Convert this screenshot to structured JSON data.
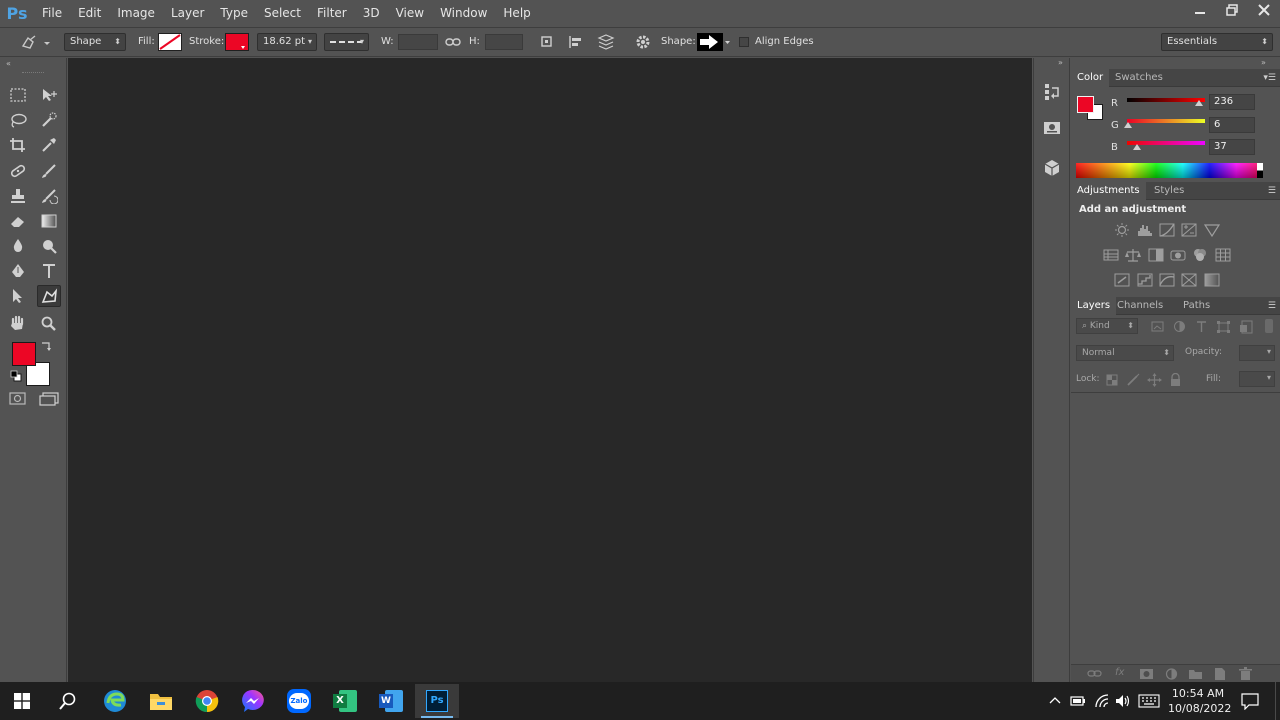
{
  "app": {
    "logo": "Ps"
  },
  "menu": [
    "File",
    "Edit",
    "Image",
    "Layer",
    "Type",
    "Select",
    "Filter",
    "3D",
    "View",
    "Window",
    "Help"
  ],
  "options": {
    "mode": "Shape",
    "fill_label": "Fill:",
    "stroke_label": "Stroke:",
    "stroke_width": "18.62 pt",
    "w_label": "W:",
    "h_label": "H:",
    "shape_label": "Shape:",
    "align_edges": "Align Edges",
    "workspace": "Essentials",
    "fill_color": "#ffffff",
    "stroke_color": "#ec0625"
  },
  "colors": {
    "foreground": "#ec0625",
    "background": "#ffffff"
  },
  "color_panel": {
    "tabs": [
      "Color",
      "Swatches"
    ],
    "channels": [
      {
        "label": "R",
        "value": "236"
      },
      {
        "label": "G",
        "value": "6"
      },
      {
        "label": "B",
        "value": "37"
      }
    ]
  },
  "adjustments_panel": {
    "tabs": [
      "Adjustments",
      "Styles"
    ],
    "heading": "Add an adjustment"
  },
  "layers_panel": {
    "tabs": [
      "Layers",
      "Channels",
      "Paths"
    ],
    "filter": "Kind",
    "blend_mode": "Normal",
    "opacity_label": "Opacity:",
    "lock_label": "Lock:",
    "fill_label": "Fill:"
  },
  "taskbar": {
    "apps": [
      "edge-icon",
      "file-explorer-icon",
      "chrome-icon",
      "messenger-icon",
      "zalo-icon",
      "excel-icon",
      "word-icon",
      "photoshop-icon"
    ],
    "zalo_text": "Zalo",
    "excel_text": "X",
    "word_text": "W",
    "ps_text": "Ps",
    "time": "10:54 AM",
    "date": "10/08/2022"
  }
}
